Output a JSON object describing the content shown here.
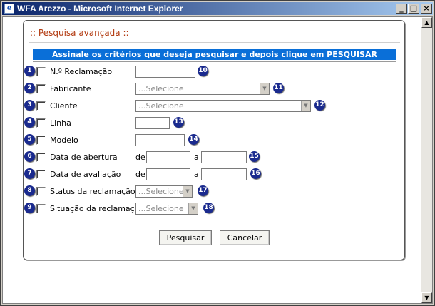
{
  "window": {
    "title": "WFA Arezzo - Microsoft Internet Explorer",
    "icon": "e",
    "buttons": {
      "minimize": "_",
      "maximize": "□",
      "close": "×"
    }
  },
  "scrollbar": {
    "up": "▲",
    "down": "▼"
  },
  "form": {
    "title": ":: Pesquisa avançada ::",
    "instructions": "Assinale os critérios que deseja pesquisar e depois clique em PESQUISAR",
    "de_label": "de",
    "a_label": "a",
    "select_arrow": "▼",
    "rows": [
      {
        "num": "1",
        "label": "N.º Reclamação",
        "field_num": "10",
        "field_type": "text",
        "value": ""
      },
      {
        "num": "2",
        "label": "Fabricante",
        "field_num": "11",
        "field_type": "select",
        "value": "...Selecione"
      },
      {
        "num": "3",
        "label": "Cliente",
        "field_num": "12",
        "field_type": "select",
        "value": "...Selecione"
      },
      {
        "num": "4",
        "label": "Linha",
        "field_num": "13",
        "field_type": "text",
        "value": ""
      },
      {
        "num": "5",
        "label": "Modelo",
        "field_num": "14",
        "field_type": "text",
        "value": ""
      },
      {
        "num": "6",
        "label": "Data de abertura",
        "field_num": "15",
        "field_type": "daterange",
        "from": "",
        "to": ""
      },
      {
        "num": "7",
        "label": "Data de avaliação",
        "field_num": "16",
        "field_type": "daterange",
        "from": "",
        "to": ""
      },
      {
        "num": "8",
        "label": "Status da reclamação",
        "field_num": "17",
        "field_type": "select",
        "value": "...Selecione"
      },
      {
        "num": "9",
        "label": "Situação da reclamação",
        "field_num": "18",
        "field_type": "select",
        "value": "...Selecione"
      }
    ],
    "buttons": {
      "search": "Pesquisar",
      "cancel": "Cancelar"
    }
  }
}
